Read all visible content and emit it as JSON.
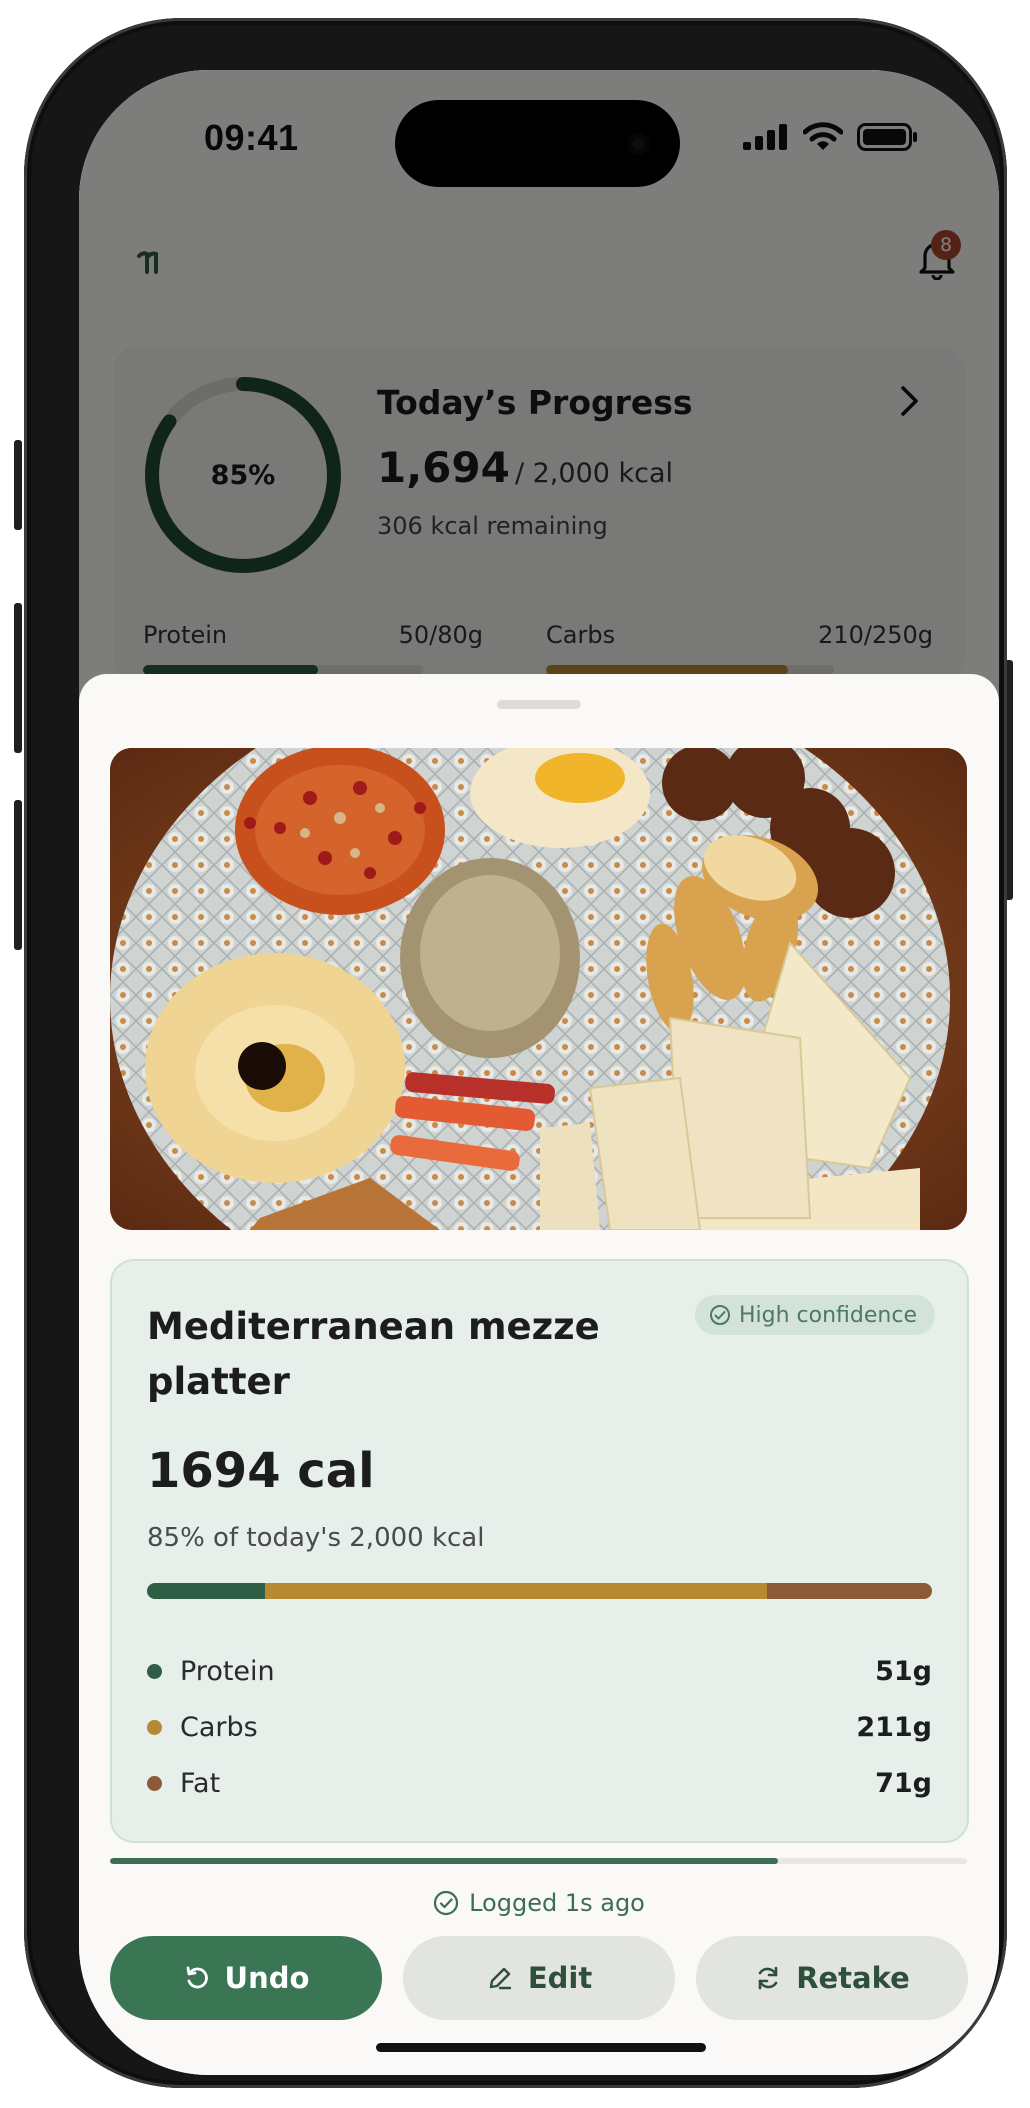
{
  "status_bar": {
    "time": "09:41"
  },
  "header": {
    "notification_count": "8"
  },
  "progress_card": {
    "ring_percent_label": "85%",
    "ring_fraction": 0.85,
    "title": "Today’s Progress",
    "consumed": "1,694",
    "goal": "/ 2,000 kcal",
    "remaining": "306 kcal remaining",
    "macros": [
      {
        "label": "Protein",
        "value": "50/80g",
        "fraction": 0.625,
        "color": "#2e5a43"
      },
      {
        "label": "Carbs",
        "value": "210/250g",
        "fraction": 0.84,
        "color": "#b58a2e"
      }
    ]
  },
  "result": {
    "food_name": "Mediterranean mezze platter",
    "confidence": "High confidence",
    "calories": "1694 cal",
    "percent_text": "85% of today's 2,000 kcal",
    "macros": [
      {
        "name": "Protein",
        "grams": "51g",
        "color": "#2f5e46",
        "share": 0.15
      },
      {
        "name": "Carbs",
        "grams": "211g",
        "color": "#b58a33",
        "share": 0.64
      },
      {
        "name": "Fat",
        "grams": "71g",
        "color": "#8c5a36",
        "share": 0.21
      }
    ]
  },
  "undo_timer_fraction": 0.78,
  "logged_text": "Logged 1s ago",
  "actions": {
    "undo": "Undo",
    "edit": "Edit",
    "retake": "Retake"
  },
  "colors": {
    "accent": "#3b7654",
    "confidence_text": "#4c7a60"
  }
}
